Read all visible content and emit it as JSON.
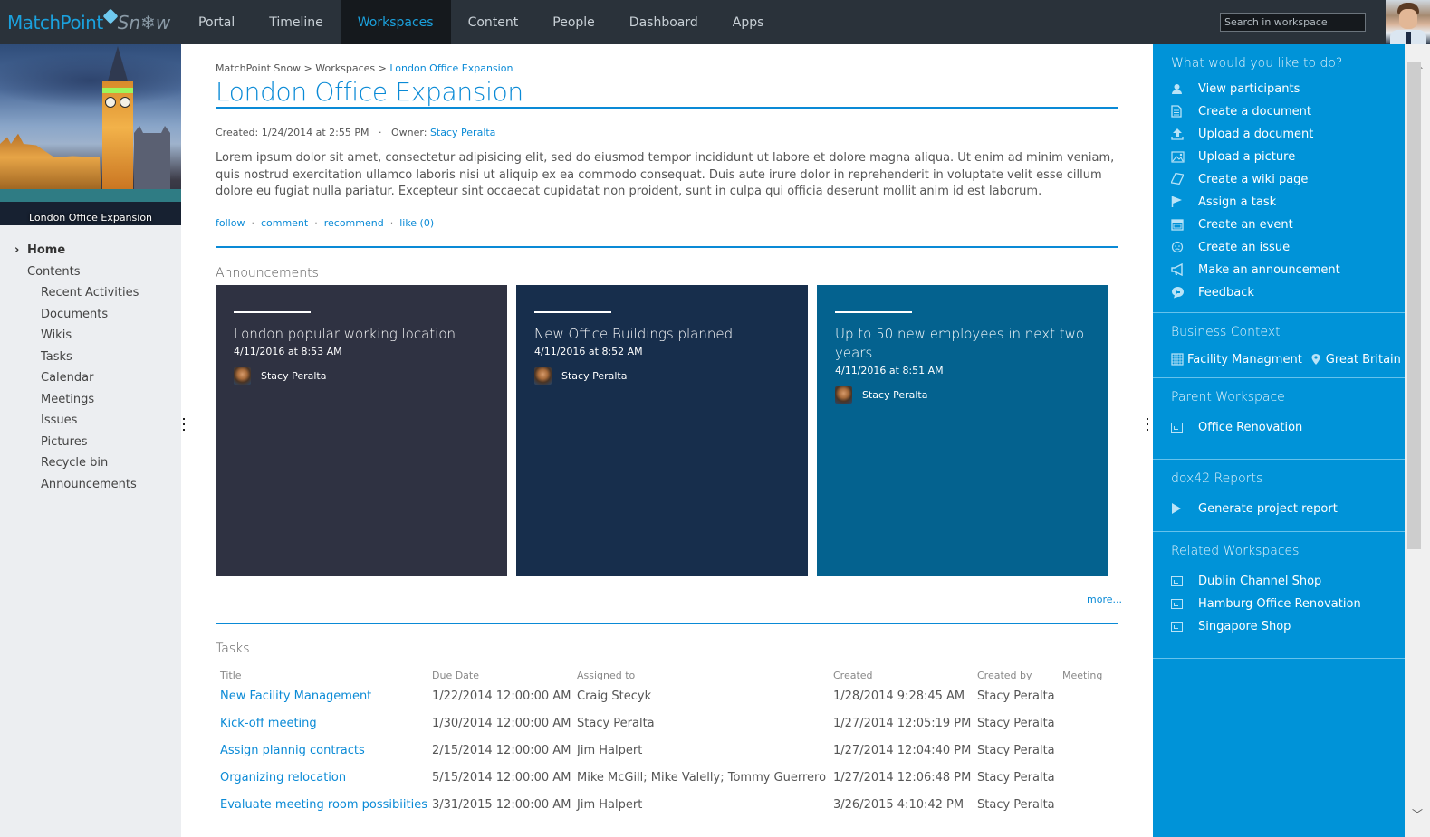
{
  "header": {
    "brand_primary": "MatchPoint",
    "brand_secondary": "Sn❄w",
    "nav": [
      {
        "label": "Portal",
        "active": false
      },
      {
        "label": "Timeline",
        "active": false
      },
      {
        "label": "Workspaces",
        "active": true
      },
      {
        "label": "Content",
        "active": false
      },
      {
        "label": "People",
        "active": false
      },
      {
        "label": "Dashboard",
        "active": false
      },
      {
        "label": "Apps",
        "active": false
      }
    ],
    "search_placeholder": "Search in workspace"
  },
  "sidebar": {
    "hero_caption": "London Office Expansion",
    "home_label": "Home",
    "contents_label": "Contents",
    "items": [
      {
        "label": "Recent Activities"
      },
      {
        "label": "Documents"
      },
      {
        "label": "Wikis"
      },
      {
        "label": "Tasks"
      },
      {
        "label": "Calendar"
      },
      {
        "label": "Meetings"
      },
      {
        "label": "Issues"
      },
      {
        "label": "Pictures"
      },
      {
        "label": "Recycle bin"
      },
      {
        "label": "Announcements"
      }
    ]
  },
  "main": {
    "breadcrumb": {
      "root": "MatchPoint Snow",
      "sep": " > ",
      "middle": "Workspaces",
      "current": "London Office Expansion"
    },
    "title": "London Office Expansion",
    "created_label": "Created: 1/24/2014 at 2:55 PM",
    "owner_label": "Owner:",
    "owner": "Stacy Peralta",
    "description": "Lorem ipsum dolor sit amet, consectetur adipisicing elit, sed do eiusmod tempor incididunt ut labore et dolore magna aliqua. Ut enim ad minim veniam, quis nostrud exercitation ullamco laboris nisi ut aliquip ex ea commodo consequat. Duis aute irure dolor in reprehenderit in voluptate velit esse cillum dolore eu fugiat nulla pariatur. Excepteur sint occaecat cupidatat non proident, sunt in culpa qui officia deserunt mollit anim id est laborum.",
    "social": {
      "follow": "follow",
      "comment": "comment",
      "recommend": "recommend",
      "like": "like (0)",
      "dot": "·"
    },
    "announcements": {
      "title": "Announcements",
      "more": "more...",
      "items": [
        {
          "title": "London popular working location",
          "date": "4/11/2016 at 8:53 AM",
          "author": "Stacy Peralta",
          "color": "#2f3242"
        },
        {
          "title": "New Office Buildings planned",
          "date": "4/11/2016 at 8:52 AM",
          "author": "Stacy Peralta",
          "color": "#172e4c"
        },
        {
          "title": "Up to 50 new employees in next two years",
          "date": "4/11/2016 at 8:51 AM",
          "author": "Stacy Peralta",
          "color": "#04628f"
        }
      ]
    },
    "tasks": {
      "title": "Tasks",
      "columns": [
        "Title",
        "Due Date",
        "Assigned to",
        "Created",
        "Created by",
        "Meeting"
      ],
      "rows": [
        {
          "title": "New Facility Management",
          "due": "1/22/2014 12:00:00 AM",
          "assigned": "Craig Stecyk",
          "created": "1/28/2014 9:28:45 AM",
          "created_by": "Stacy Peralta",
          "meeting": ""
        },
        {
          "title": "Kick-off meeting",
          "due": "1/30/2014 12:00:00 AM",
          "assigned": "Stacy Peralta",
          "created": "1/27/2014 12:05:19 PM",
          "created_by": "Stacy Peralta",
          "meeting": ""
        },
        {
          "title": "Assign plannig contracts",
          "due": "2/15/2014 12:00:00 AM",
          "assigned": "Jim Halpert",
          "created": "1/27/2014 12:04:40 PM",
          "created_by": "Stacy Peralta",
          "meeting": ""
        },
        {
          "title": "Organizing relocation",
          "due": "5/15/2014 12:00:00 AM",
          "assigned": "Mike McGill; Mike Valelly; Tommy Guerrero",
          "created": "1/27/2014 12:06:48 PM",
          "created_by": "Stacy Peralta",
          "meeting": ""
        },
        {
          "title": "Evaluate meeting room possibiities",
          "due": "3/31/2015 12:00:00 AM",
          "assigned": "Jim Halpert",
          "created": "3/26/2015 4:10:42 PM",
          "created_by": "Stacy Peralta",
          "meeting": ""
        }
      ]
    }
  },
  "rightpanel": {
    "actions_title": "What would you like to do?",
    "actions": [
      {
        "label": "View participants",
        "icon": "user-icon"
      },
      {
        "label": "Create a document",
        "icon": "document-icon"
      },
      {
        "label": "Upload a document",
        "icon": "upload-icon"
      },
      {
        "label": "Upload a picture",
        "icon": "picture-icon"
      },
      {
        "label": "Create a wiki page",
        "icon": "wiki-page-icon"
      },
      {
        "label": "Assign a task",
        "icon": "flag-icon"
      },
      {
        "label": "Create an event",
        "icon": "calendar-icon"
      },
      {
        "label": "Create an issue",
        "icon": "issue-icon"
      },
      {
        "label": "Make an announcement",
        "icon": "megaphone-icon"
      },
      {
        "label": "Feedback",
        "icon": "feedback-icon"
      }
    ],
    "business_context": {
      "title": "Business Context",
      "department": "Facility Managment",
      "location": "Great Britain"
    },
    "parent_workspace": {
      "title": "Parent Workspace",
      "items": [
        {
          "label": "Office Renovation"
        }
      ]
    },
    "reports": {
      "title": "dox42 Reports",
      "items": [
        {
          "label": "Generate project report"
        }
      ]
    },
    "related_workspaces": {
      "title": "Related Workspaces",
      "items": [
        {
          "label": "Dublin Channel Shop"
        },
        {
          "label": "Hamburg Office Renovation"
        },
        {
          "label": "Singapore Shop"
        }
      ]
    }
  },
  "icons": {
    "chevron_right": "›",
    "scroll_up": "︿",
    "scroll_down": "﹀"
  }
}
